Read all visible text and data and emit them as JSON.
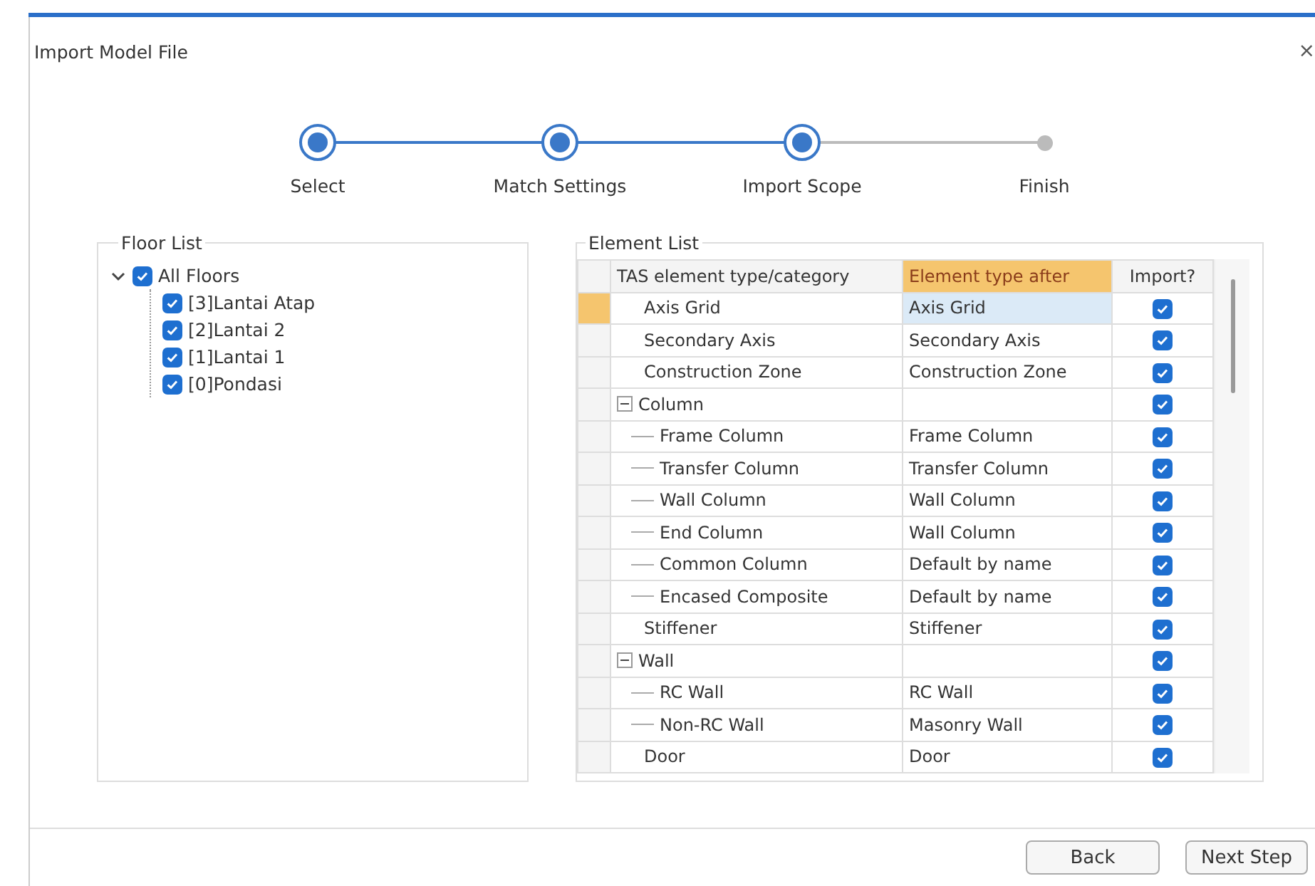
{
  "window": {
    "title": "Import Model File",
    "close": "×"
  },
  "steps": [
    {
      "label": "Select",
      "done": true
    },
    {
      "label": "Match Settings",
      "done": true
    },
    {
      "label": "Import Scope",
      "done": true
    },
    {
      "label": "Finish",
      "done": false
    }
  ],
  "floor_list": {
    "title": "Floor List",
    "items": [
      {
        "label": "All Floors",
        "checked": true,
        "expanded": true,
        "children": [
          {
            "label": "[3]Lantai Atap",
            "checked": true
          },
          {
            "label": "[2]Lantai 2",
            "checked": true
          },
          {
            "label": "[1]Lantai 1",
            "checked": true
          },
          {
            "label": "[0]Pondasi",
            "checked": true
          }
        ]
      }
    ]
  },
  "element_list": {
    "title": "Element List",
    "columns": [
      {
        "label": "TAS element type/category",
        "highlighted": false
      },
      {
        "label": "Element type after",
        "highlighted": true
      },
      {
        "label": "Import?",
        "highlighted": false
      }
    ],
    "rows": [
      {
        "category": "Axis Grid",
        "type_after": "Axis Grid",
        "import": true,
        "selected": true
      },
      {
        "category": "Secondary Axis",
        "type_after": "Secondary Axis",
        "import": true,
        "selected": false
      },
      {
        "category": "Construction Zone",
        "type_after": "Construction Zone",
        "import": true,
        "selected": false
      },
      {
        "category": "Column",
        "import": true,
        "selected": false,
        "expanded": true,
        "children": [
          {
            "category": "Frame Column",
            "type_after": "Frame Column",
            "import": true,
            "selected": false
          },
          {
            "category": "Transfer Column",
            "type_after": "Transfer Column",
            "import": true,
            "selected": false
          },
          {
            "category": "Wall Column",
            "type_after": "Wall Column",
            "import": true,
            "selected": false
          },
          {
            "category": "End Column",
            "type_after": "Wall Column",
            "import": true,
            "selected": false
          },
          {
            "category": "Common Column",
            "type_after": "Default by name",
            "import": true,
            "selected": false
          },
          {
            "category": "Encased Composite",
            "type_after": "Default by name",
            "import": true,
            "selected": false
          }
        ]
      },
      {
        "category": "Stiffener",
        "type_after": "Stiffener",
        "import": true,
        "selected": false
      },
      {
        "category": "Wall",
        "import": true,
        "selected": false,
        "expanded": true,
        "children": [
          {
            "category": "RC Wall",
            "type_after": "RC Wall",
            "import": true,
            "selected": false
          },
          {
            "category": "Non-RC Wall",
            "type_after": "Masonry Wall",
            "import": true,
            "selected": false
          }
        ]
      },
      {
        "category": "Door",
        "type_after": "Door",
        "import": true,
        "selected": false
      }
    ]
  },
  "buttons": [
    {
      "label": "Back"
    },
    {
      "label": "Next Step"
    }
  ]
}
